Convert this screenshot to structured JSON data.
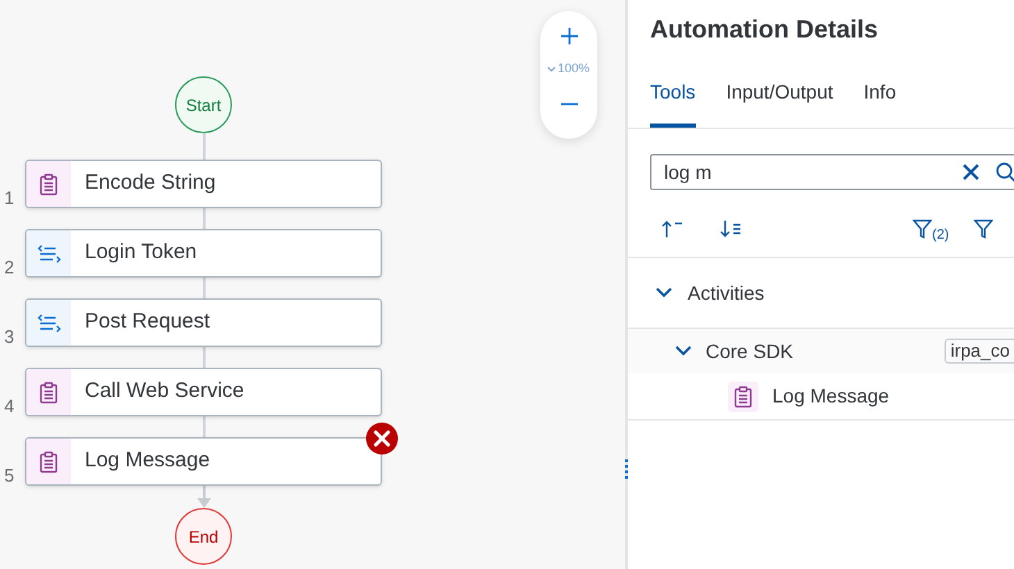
{
  "flow": {
    "start": "Start",
    "end": "End",
    "steps": [
      {
        "number": "1",
        "label": "Encode String",
        "kind": "activity",
        "error": false
      },
      {
        "number": "2",
        "label": "Login Token",
        "kind": "flow",
        "error": false
      },
      {
        "number": "3",
        "label": "Post Request",
        "kind": "flow",
        "error": false
      },
      {
        "number": "4",
        "label": "Call Web Service",
        "kind": "activity",
        "error": false
      },
      {
        "number": "5",
        "label": "Log Message",
        "kind": "activity",
        "error": true
      }
    ]
  },
  "zoom": {
    "level_text": "100%"
  },
  "panel": {
    "title": "Automation Details",
    "tabs": [
      {
        "label": "Tools",
        "selected": true
      },
      {
        "label": "Input/Output",
        "selected": false
      },
      {
        "label": "Info",
        "selected": false
      }
    ],
    "search": {
      "value": "log m"
    },
    "filter_count": "(2)",
    "tree": [
      {
        "label": "Activities",
        "expanded": true,
        "children": [
          {
            "label": "Core SDK",
            "expanded": true,
            "tag": "irpa_co",
            "children": [
              {
                "label": "Log Message",
                "kind": "activity"
              }
            ]
          }
        ]
      }
    ]
  }
}
